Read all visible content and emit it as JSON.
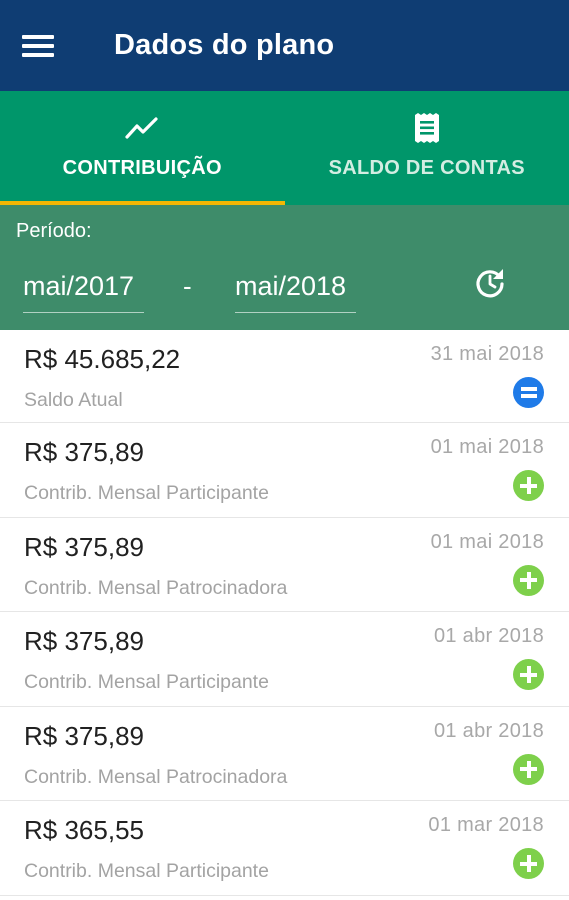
{
  "appbar": {
    "title": "Dados do plano",
    "menu_icon": "menu-icon"
  },
  "tabs": [
    {
      "label": "CONTRIBUIÇÃO",
      "icon": "trending-up-icon",
      "active": true
    },
    {
      "label": "SALDO DE CONTAS",
      "icon": "receipt-icon",
      "active": false
    }
  ],
  "period": {
    "label": "Período:",
    "from": "mai/2017",
    "separator": "-",
    "to": "mai/2018",
    "refresh_icon": "refresh-icon"
  },
  "colors": {
    "appbar": "#0f3d73",
    "tabs": "#00966a",
    "indicator": "#f2b705",
    "period_bg": "#3e8c6a",
    "plus_badge": "#7ed04b",
    "equal_badge": "#1f7be8"
  },
  "entries": [
    {
      "amount": "R$ 45.685,22",
      "desc": "Saldo Atual",
      "date": "31 mai 2018",
      "badge": "equal-icon"
    },
    {
      "amount": "R$ 375,89",
      "desc": "Contrib. Mensal Participante",
      "date": "01 mai 2018",
      "badge": "plus-icon"
    },
    {
      "amount": "R$ 375,89",
      "desc": "Contrib. Mensal Patrocinadora",
      "date": "01 mai 2018",
      "badge": "plus-icon"
    },
    {
      "amount": "R$ 375,89",
      "desc": "Contrib. Mensal Participante",
      "date": "01 abr 2018",
      "badge": "plus-icon"
    },
    {
      "amount": "R$ 375,89",
      "desc": "Contrib. Mensal Patrocinadora",
      "date": "01 abr 2018",
      "badge": "plus-icon"
    },
    {
      "amount": "R$ 365,55",
      "desc": "Contrib. Mensal Participante",
      "date": "01 mar 2018",
      "badge": "plus-icon"
    }
  ]
}
